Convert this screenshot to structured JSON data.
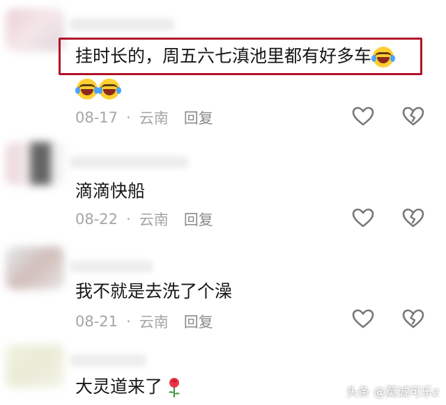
{
  "comments": [
    {
      "text": "挂时长的，周五六七滇池里都有好多车",
      "date": "08-17",
      "location": "云南",
      "reply_label": "回复",
      "emojis": [
        "laughing-crying-emoji",
        "laughing-crying-emoji",
        "laughing-crying-emoji"
      ]
    },
    {
      "text": "滴滴快船",
      "date": "08-22",
      "location": "云南",
      "reply_label": "回复"
    },
    {
      "text": "我不就是去洗了个澡",
      "date": "08-21",
      "location": "云南",
      "reply_label": "回复"
    },
    {
      "text": "大灵道来了",
      "emoji": "rose-emoji"
    }
  ],
  "separator": "·",
  "icons": {
    "like": "heart-icon",
    "dislike": "broken-heart-icon"
  },
  "colors": {
    "highlight_border": "#b01226",
    "meta_text": "#a5a5a5",
    "icon_stroke": "#777777"
  },
  "watermark": "头条 @莫诚可乐z"
}
